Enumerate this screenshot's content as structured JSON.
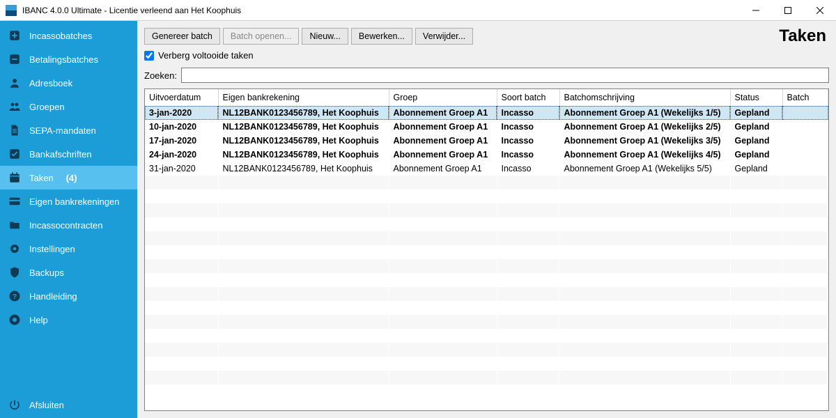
{
  "window": {
    "title": "IBANC 4.0.0 Ultimate - Licentie verleend aan Het Koophuis"
  },
  "sidebar": {
    "items": [
      {
        "key": "incassobatches",
        "label": "Incassobatches",
        "icon": "plus-box-icon"
      },
      {
        "key": "betalingsbatches",
        "label": "Betalingsbatches",
        "icon": "minus-box-icon"
      },
      {
        "key": "adresboek",
        "label": "Adresboek",
        "icon": "person-icon"
      },
      {
        "key": "groepen",
        "label": "Groepen",
        "icon": "people-icon"
      },
      {
        "key": "sepa-mandaten",
        "label": "SEPA-mandaten",
        "icon": "document-icon"
      },
      {
        "key": "bankafschriften",
        "label": "Bankafschriften",
        "icon": "check-box-icon"
      },
      {
        "key": "taken",
        "label": "Taken",
        "icon": "calendar-icon",
        "badge": "(4)",
        "active": true
      },
      {
        "key": "eigen-bankrekeningen",
        "label": "Eigen bankrekeningen",
        "icon": "card-icon"
      },
      {
        "key": "incassocontracten",
        "label": "Incassocontracten",
        "icon": "folder-icon"
      },
      {
        "key": "instellingen",
        "label": "Instellingen",
        "icon": "gear-icon"
      },
      {
        "key": "backups",
        "label": "Backups",
        "icon": "shield-icon"
      },
      {
        "key": "handleiding",
        "label": "Handleiding",
        "icon": "help-icon"
      },
      {
        "key": "help",
        "label": "Help",
        "icon": "life-ring-icon"
      }
    ],
    "exit": {
      "label": "Afsluiten",
      "icon": "power-icon"
    }
  },
  "page": {
    "title": "Taken",
    "toolbar": {
      "generate": "Genereer batch",
      "open": "Batch openen...",
      "new": "Nieuw...",
      "edit": "Bewerken...",
      "delete": "Verwijder..."
    },
    "hide_completed": {
      "label": "Verberg voltooide taken",
      "checked": true
    },
    "search": {
      "label": "Zoeken:",
      "value": ""
    }
  },
  "table": {
    "columns": {
      "date": "Uitvoerdatum",
      "acct": "Eigen bankrekening",
      "group": "Groep",
      "type": "Soort batch",
      "desc": "Batchomschrijving",
      "status": "Status",
      "batch": "Batch"
    },
    "rows": [
      {
        "date": "3-jan-2020",
        "acct": "NL12BANK0123456789, Het Koophuis",
        "group": "Abonnement Groep A1",
        "type": "Incasso",
        "desc": "Abonnement Groep A1 (Wekelijks 1/5)",
        "status": "Gepland",
        "batch": "",
        "bold": true,
        "selected": true
      },
      {
        "date": "10-jan-2020",
        "acct": "NL12BANK0123456789, Het Koophuis",
        "group": "Abonnement Groep A1",
        "type": "Incasso",
        "desc": "Abonnement Groep A1 (Wekelijks 2/5)",
        "status": "Gepland",
        "batch": "",
        "bold": true
      },
      {
        "date": "17-jan-2020",
        "acct": "NL12BANK0123456789, Het Koophuis",
        "group": "Abonnement Groep A1",
        "type": "Incasso",
        "desc": "Abonnement Groep A1 (Wekelijks 3/5)",
        "status": "Gepland",
        "batch": "",
        "bold": true
      },
      {
        "date": "24-jan-2020",
        "acct": "NL12BANK0123456789, Het Koophuis",
        "group": "Abonnement Groep A1",
        "type": "Incasso",
        "desc": "Abonnement Groep A1 (Wekelijks 4/5)",
        "status": "Gepland",
        "batch": "",
        "bold": true
      },
      {
        "date": "31-jan-2020",
        "acct": "NL12BANK0123456789, Het Koophuis",
        "group": "Abonnement Groep A1",
        "type": "Incasso",
        "desc": "Abonnement Groep A1 (Wekelijks 5/5)",
        "status": "Gepland",
        "batch": "",
        "bold": false
      }
    ]
  }
}
